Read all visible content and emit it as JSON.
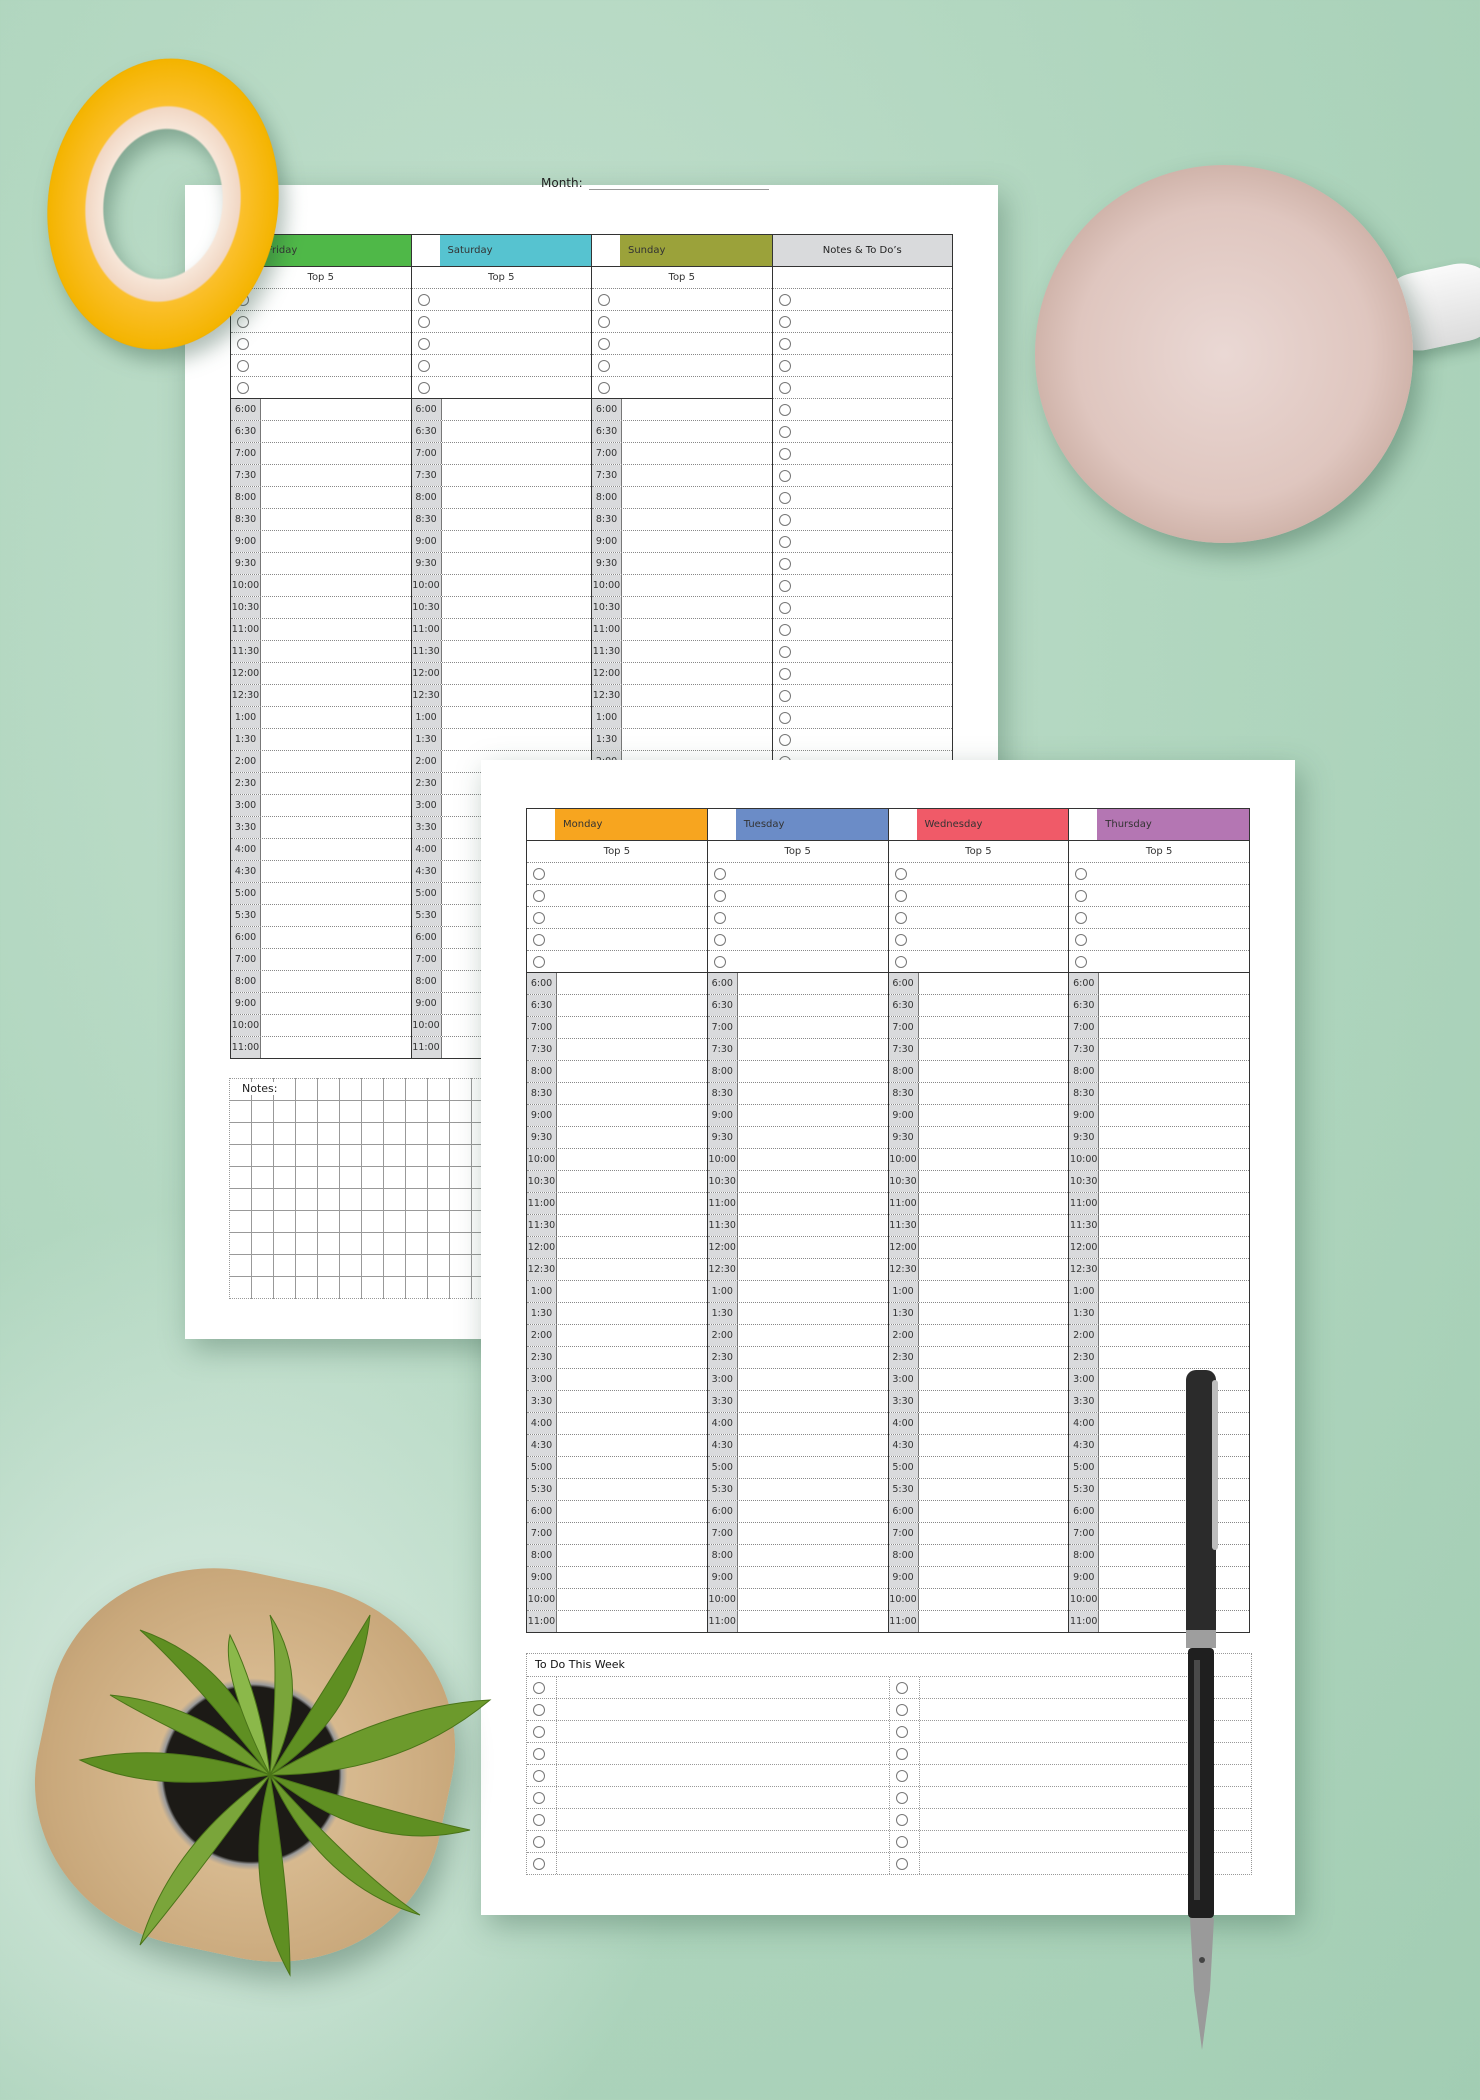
{
  "page1": {
    "month_label": "Month:",
    "days": [
      {
        "name": "Friday",
        "color": "#4fb848",
        "top5_label": "Top 5"
      },
      {
        "name": "Saturday",
        "color": "#56c3d0",
        "top5_label": "Top 5"
      },
      {
        "name": "Sunday",
        "color": "#9ba23a",
        "top5_label": "Top 5"
      }
    ],
    "notes_column": {
      "label": "Notes & To Do’s",
      "color": "#d9dadc",
      "rows": 35
    },
    "notes_section_label": "Notes:"
  },
  "page2": {
    "days": [
      {
        "name": "Monday",
        "color": "#f7a51f",
        "top5_label": "Top 5"
      },
      {
        "name": "Tuesday",
        "color": "#6b8cc7",
        "top5_label": "Top 5"
      },
      {
        "name": "Wednesday",
        "color": "#f05a68",
        "top5_label": "Top 5"
      },
      {
        "name": "Thursday",
        "color": "#b476b3",
        "top5_label": "Top 5"
      }
    ],
    "todo_title": "To Do This Week",
    "todo_rows": 9
  },
  "top5_count": 5,
  "times": [
    "6:00",
    "6:30",
    "7:00",
    "7:30",
    "8:00",
    "8:30",
    "9:00",
    "9:30",
    "10:00",
    "10:30",
    "11:00",
    "11:30",
    "12:00",
    "12:30",
    "1:00",
    "1:30",
    "2:00",
    "2:30",
    "3:00",
    "3:30",
    "4:00",
    "4:30",
    "5:00",
    "5:30",
    "6:00",
    "7:00",
    "8:00",
    "9:00",
    "10:00",
    "11:00"
  ],
  "decor": {
    "background": "#b2d7c0",
    "tape": "#f4b400",
    "mug": "#f2f2f4",
    "pen": "#1e1e1e"
  }
}
